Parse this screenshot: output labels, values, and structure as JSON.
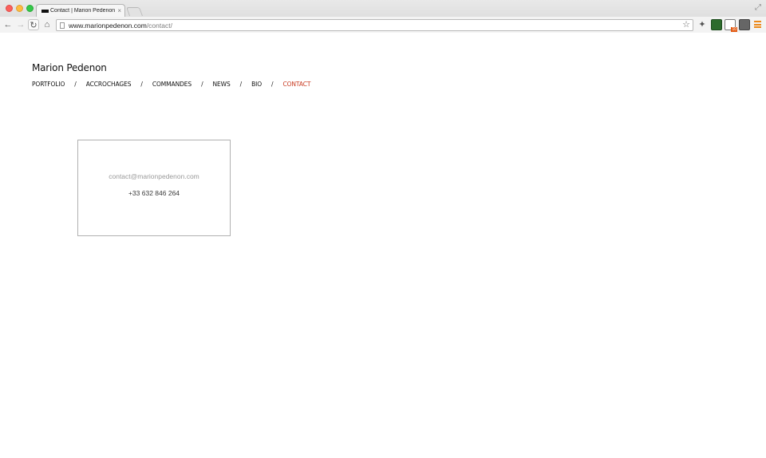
{
  "browser": {
    "tab_title": "Contact | Marion Pedenon",
    "tab_close": "×",
    "url_host": "www.marionpedenon.com",
    "url_path": "/contact/",
    "ext_badge": "10"
  },
  "icons": {
    "back": "←",
    "forward": "→",
    "reload": "↻",
    "home": "⌂",
    "star": "☆",
    "extension": "✦",
    "fullscreen": "⤢"
  },
  "site": {
    "title": "Marion Pedenon",
    "nav": [
      {
        "label": "PORTFOLIO"
      },
      {
        "label": "ACCROCHAGES"
      },
      {
        "label": "COMMANDES"
      },
      {
        "label": "NEWS"
      },
      {
        "label": "BIO"
      },
      {
        "label": "CONTACT",
        "active": true
      }
    ],
    "nav_separator": "/"
  },
  "contact": {
    "email": "contact@marionpedenon.com",
    "phone": "+33 632 846 264"
  },
  "colors": {
    "nav_active": "#c8391f",
    "menu_icon": "#ec8a1b"
  }
}
